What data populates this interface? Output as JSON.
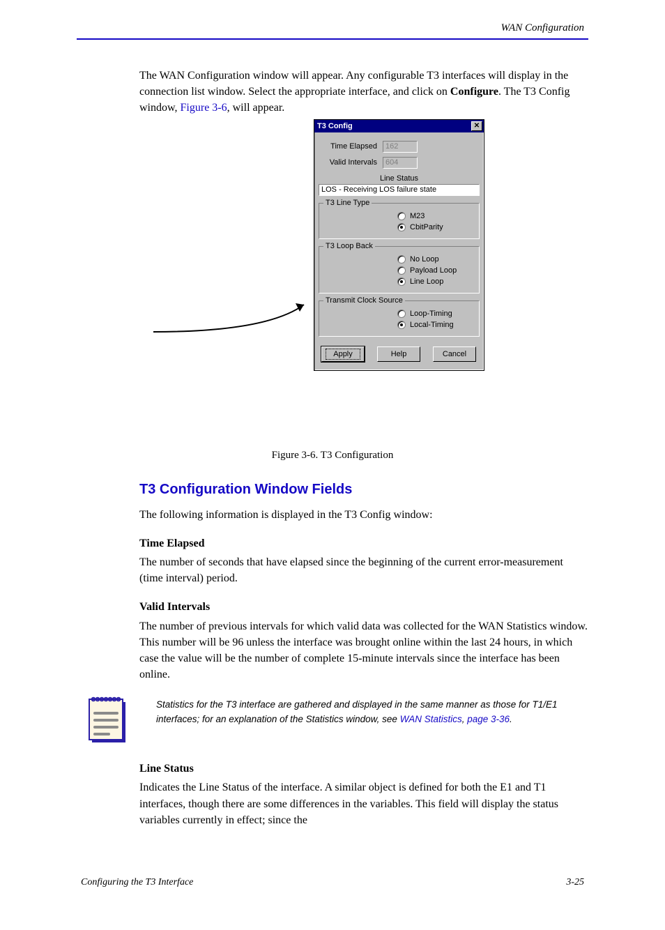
{
  "running_head": "WAN Configuration",
  "intro": {
    "text_before_link": "The WAN Configuration window will appear. Any configurable T3 interfaces will display in the connection list window. Select the appropriate interface, and click on ",
    "bold_word": "Configure",
    "text_after_bold": ". The T3 Config window, ",
    "link_text": "Figure 3-6",
    "text_after_link": ", will appear."
  },
  "dialog": {
    "title": "T3 Config",
    "time_elapsed_label": "Time Elapsed",
    "time_elapsed_value": "162",
    "valid_intervals_label": "Valid Intervals",
    "valid_intervals_value": "604",
    "line_status_caption": "Line Status",
    "line_status_value": "LOS - Receiving LOS failure state",
    "groups": {
      "line_type": {
        "legend": "T3 Line Type",
        "options": [
          "M23",
          "CbitParity"
        ],
        "selected": 1
      },
      "loop_back": {
        "legend": "T3 Loop Back",
        "options": [
          "No Loop",
          "Payload Loop",
          "Line Loop"
        ],
        "selected": 2
      },
      "clock": {
        "legend": "Transmit Clock Source",
        "options": [
          "Loop-Timing",
          "Local-Timing"
        ],
        "selected": 1
      }
    },
    "buttons": {
      "apply": "Apply",
      "help": "Help",
      "cancel": "Cancel"
    }
  },
  "figure_caption": "Figure 3-6. T3 Configuration",
  "section_heading": "T3 Configuration Window Fields",
  "section_intro": "The following information is displayed in the T3 Config window:",
  "fields": {
    "time_elapsed": {
      "title": "Time Elapsed",
      "body": "The number of seconds that have elapsed since the beginning of the current error-measurement (time interval) period."
    },
    "valid_intervals": {
      "title": "Valid Intervals",
      "body": "The number of previous intervals for which valid data was collected for the WAN Statistics window. This number will be 96 unless the interface was brought online within the last 24 hours, in which case the value will be the number of complete 15-minute intervals since the interface has been online."
    },
    "line_status": {
      "title": "Line Status",
      "body": "Indicates the Line Status of the interface. A similar object is defined for both the E1 and T1 interfaces, though there are some differences in the variables. This field will display the status variables currently in effect; since the"
    }
  },
  "note": {
    "text_before_link": "Statistics for the T3 interface are gathered and displayed in the same manner as those for T1/E1 interfaces; for an explanation of the Statistics window, see ",
    "note_link": "WAN Statistics",
    "text_after_link": ", ",
    "page_link": "page 3-36",
    "tail": "."
  },
  "footer": {
    "left": "Configuring the T3 Interface",
    "right": "3-25"
  }
}
